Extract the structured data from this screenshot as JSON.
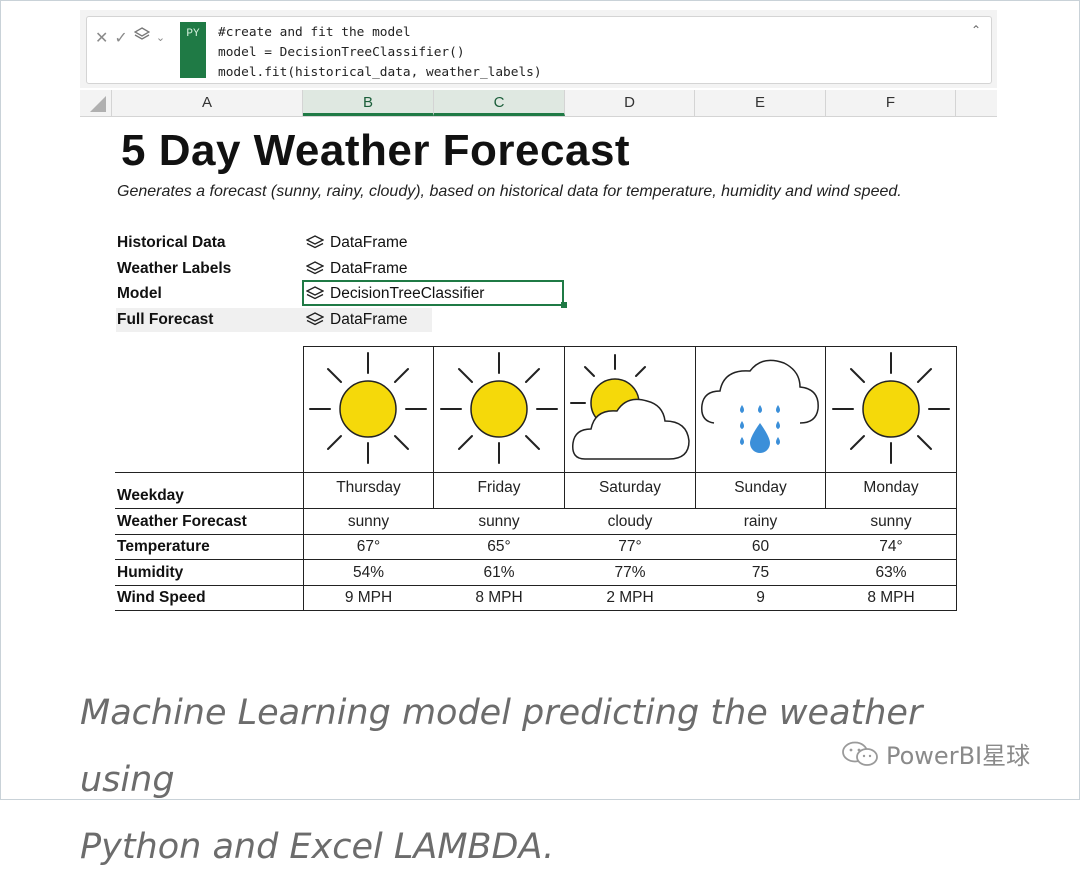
{
  "formula_bar": {
    "badge": "PY",
    "code_lines": [
      "#create and fit the model",
      "model = DecisionTreeClassifier()",
      "model.fit(historical_data, weather_labels)"
    ]
  },
  "columns": [
    "A",
    "B",
    "C",
    "D",
    "E",
    "F"
  ],
  "sheet": {
    "title": "5 Day Weather Forecast",
    "subtitle": "Generates a forecast (sunny, rainy, cloudy), based on historical data for temperature, humidity and wind speed.",
    "params": [
      {
        "label": "Historical Data",
        "value": "DataFrame"
      },
      {
        "label": "Weather Labels",
        "value": "DataFrame"
      },
      {
        "label": "Model",
        "value": "DecisionTreeClassifier"
      },
      {
        "label": "Full Forecast",
        "value": "DataFrame"
      }
    ]
  },
  "forecast": {
    "row_labels": [
      "Weekday",
      "Weather Forecast",
      "Temperature",
      "Humidity",
      "Wind Speed"
    ],
    "days": [
      {
        "weekday": "Thursday",
        "forecast": "sunny",
        "temp": "67°",
        "humidity": "54%",
        "wind": "9 MPH",
        "icon": "sun-icon"
      },
      {
        "weekday": "Friday",
        "forecast": "sunny",
        "temp": "65°",
        "humidity": "61%",
        "wind": "8 MPH",
        "icon": "sun-icon"
      },
      {
        "weekday": "Saturday",
        "forecast": "cloudy",
        "temp": "77°",
        "humidity": "77%",
        "wind": "2 MPH",
        "icon": "cloudy-icon"
      },
      {
        "weekday": "Sunday",
        "forecast": "rainy",
        "temp": "60",
        "humidity": "75",
        "wind": "9",
        "icon": "rain-icon"
      },
      {
        "weekday": "Monday",
        "forecast": "sunny",
        "temp": "74°",
        "humidity": "63%",
        "wind": "8 MPH",
        "icon": "sun-icon"
      }
    ]
  },
  "caption": {
    "line1": "Machine Learning model predicting the weather using",
    "line2": "Python and Excel LAMBDA."
  },
  "watermark": "PowerBI星球",
  "colors": {
    "accent": "#1f7a45",
    "sun": "#f5d90a",
    "rain": "#3b8fd9"
  }
}
